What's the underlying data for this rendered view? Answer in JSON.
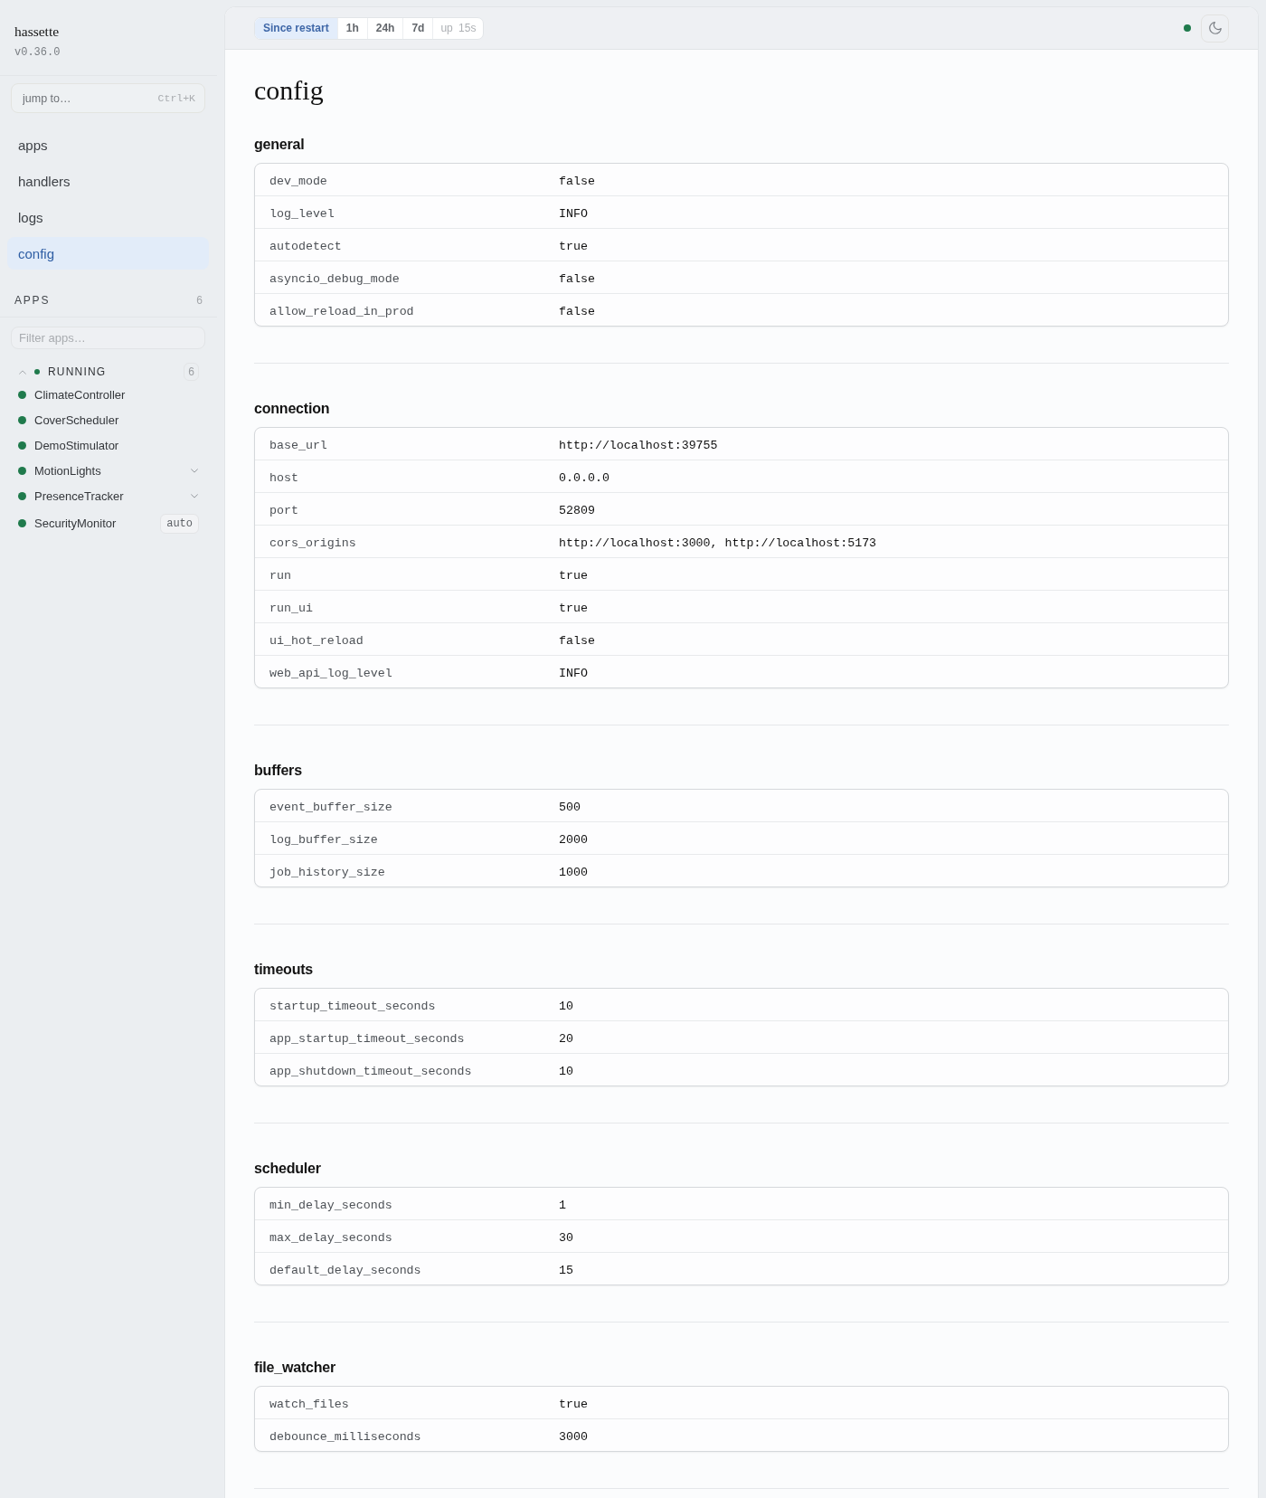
{
  "sidebar": {
    "brand": {
      "name": "hassette",
      "version": "v0.36.0"
    },
    "jump": {
      "placeholder": "jump to…",
      "shortcut": "Ctrl+K"
    },
    "nav": [
      {
        "label": "apps",
        "selected": false
      },
      {
        "label": "handlers",
        "selected": false
      },
      {
        "label": "logs",
        "selected": false
      },
      {
        "label": "config",
        "selected": true
      }
    ],
    "apps": {
      "title": "APPS",
      "count": "6",
      "filter": {
        "placeholder": "Filter apps…"
      },
      "groups": [
        {
          "label": "RUNNING",
          "count": "6",
          "expanded": true,
          "color": "#1f7a4c",
          "items": [
            {
              "name": "ClimateController",
              "color": "#1f7a4c",
              "kind": "single"
            },
            {
              "name": "CoverScheduler",
              "color": "#1f7a4c",
              "kind": "single"
            },
            {
              "name": "DemoStimulator",
              "color": "#1f7a4c",
              "kind": "single"
            },
            {
              "name": "MotionLights",
              "color": "#1f7a4c",
              "kind": "group",
              "expanded": false
            },
            {
              "name": "PresenceTracker",
              "color": "#1f7a4c",
              "kind": "group",
              "expanded": false
            },
            {
              "name": "SecurityMonitor",
              "color": "#1f7a4c",
              "kind": "single",
              "badge": "auto"
            }
          ]
        }
      ]
    }
  },
  "topbar": {
    "ranges": [
      {
        "label": "Since restart",
        "selected": true
      },
      {
        "label": "1h",
        "selected": false
      },
      {
        "label": "24h",
        "selected": false
      },
      {
        "label": "7d",
        "selected": false
      }
    ],
    "uptime": "up 15s",
    "connection": {
      "color": "#1f7a4c"
    }
  },
  "page": {
    "title": "config",
    "sections": [
      {
        "title": "general",
        "rows": [
          {
            "key": "dev_mode",
            "value": "false"
          },
          {
            "key": "log_level",
            "value": "INFO"
          },
          {
            "key": "autodetect",
            "value": "true"
          },
          {
            "key": "asyncio_debug_mode",
            "value": "false"
          },
          {
            "key": "allow_reload_in_prod",
            "value": "false"
          }
        ]
      },
      {
        "title": "connection",
        "rows": [
          {
            "key": "base_url",
            "value": "http://localhost:39755"
          },
          {
            "key": "host",
            "value": "0.0.0.0"
          },
          {
            "key": "port",
            "value": "52809"
          },
          {
            "key": "cors_origins",
            "value": "http://localhost:3000, http://localhost:5173"
          },
          {
            "key": "run",
            "value": "true"
          },
          {
            "key": "run_ui",
            "value": "true"
          },
          {
            "key": "ui_hot_reload",
            "value": "false"
          },
          {
            "key": "web_api_log_level",
            "value": "INFO"
          }
        ]
      },
      {
        "title": "buffers",
        "rows": [
          {
            "key": "event_buffer_size",
            "value": "500"
          },
          {
            "key": "log_buffer_size",
            "value": "2000"
          },
          {
            "key": "job_history_size",
            "value": "1000"
          }
        ]
      },
      {
        "title": "timeouts",
        "rows": [
          {
            "key": "startup_timeout_seconds",
            "value": "10"
          },
          {
            "key": "app_startup_timeout_seconds",
            "value": "20"
          },
          {
            "key": "app_shutdown_timeout_seconds",
            "value": "10"
          }
        ]
      },
      {
        "title": "scheduler",
        "rows": [
          {
            "key": "min_delay_seconds",
            "value": "1"
          },
          {
            "key": "max_delay_seconds",
            "value": "30"
          },
          {
            "key": "default_delay_seconds",
            "value": "15"
          }
        ]
      },
      {
        "title": "file_watcher",
        "rows": [
          {
            "key": "watch_files",
            "value": "true"
          },
          {
            "key": "debounce_milliseconds",
            "value": "3000"
          }
        ]
      }
    ]
  }
}
